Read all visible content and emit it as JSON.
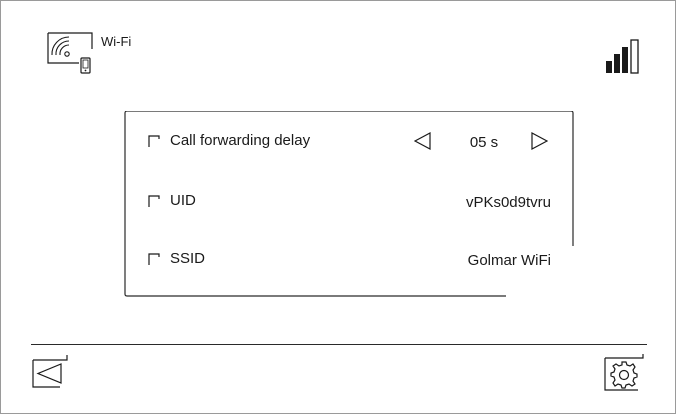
{
  "header": {
    "title": "Wi-Fi",
    "wifi_icon": "wifi-phone-icon",
    "signal_icon": "signal-strength-icon"
  },
  "settings": {
    "rows": [
      {
        "label": "Call forwarding delay",
        "value": "05 s",
        "has_arrows": true
      },
      {
        "label": "UID",
        "value": "vPKs0d9tvru",
        "has_arrows": false
      },
      {
        "label": "SSID",
        "value": "Golmar WiFi",
        "has_arrows": false
      }
    ]
  },
  "footer": {
    "back_icon": "back-triangle-icon",
    "settings_icon": "gear-icon"
  },
  "colors": {
    "stroke": "#1a1a1a",
    "border": "#9a9a9a",
    "background": "#ffffff"
  }
}
